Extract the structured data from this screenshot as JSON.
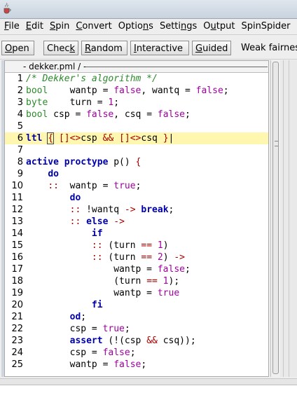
{
  "titlebar": {
    "icon": "java-cup-icon"
  },
  "menu": [
    {
      "pre": "",
      "ul": "F",
      "post": "ile"
    },
    {
      "pre": "",
      "ul": "E",
      "post": "dit"
    },
    {
      "pre": "",
      "ul": "S",
      "post": "pin"
    },
    {
      "pre": "",
      "ul": "C",
      "post": "onvert"
    },
    {
      "pre": "Optio",
      "ul": "n",
      "post": "s"
    },
    {
      "pre": "Setti",
      "ul": "n",
      "post": "gs"
    },
    {
      "pre": "O",
      "ul": "u",
      "post": "tput"
    },
    {
      "pre": "SpinSpider",
      "ul": "",
      "post": ""
    }
  ],
  "toolbar": {
    "open": {
      "pre": "",
      "ul": "O",
      "post": "pen"
    },
    "check": {
      "pre": "Chec",
      "ul": "k",
      "post": ""
    },
    "random": {
      "pre": "",
      "ul": "R",
      "post": "andom"
    },
    "interactive": {
      "pre": "",
      "ul": "I",
      "post": "nteractive"
    },
    "guided": {
      "pre": "",
      "ul": "G",
      "post": "uided"
    },
    "weak": {
      "pre": "Weak fairness",
      "ul": "",
      "post": ""
    }
  },
  "editor": {
    "tab_title": "- dekker.pml / -",
    "lines": [
      {
        "n": "1",
        "html": "<span class='cm'>/* Dekker's algorithm */</span>"
      },
      {
        "n": "2",
        "html": "<span class='ty'>bool</span>    wantp = <span class='lit'>false</span>, wantq = <span class='lit'>false</span>;"
      },
      {
        "n": "3",
        "html": "<span class='ty'>byte</span>    turn = <span class='lit'>1</span>;"
      },
      {
        "n": "4",
        "html": "<span class='ty'>bool</span> csp = <span class='lit'>false</span>, csq = <span class='lit'>false</span>;"
      },
      {
        "n": "5",
        "html": ""
      },
      {
        "n": "6",
        "html": "<span class='kw'>ltl</span> <span class='op brk'>{</span> <span class='op'>[]&lt;&gt;</span>csp <span class='op'>&amp;&amp;</span> <span class='op'>[]&lt;&gt;</span>csq <span class='op'>}</span>|",
        "hl": true
      },
      {
        "n": "7",
        "html": ""
      },
      {
        "n": "8",
        "html": "<span class='kw'>active proctype</span> p() <span class='op'>{</span>"
      },
      {
        "n": "9",
        "html": "    <span class='kw'>do</span>"
      },
      {
        "n": "10",
        "html": "    <span class='op'>::</span>  wantp = <span class='lit'>true</span>;"
      },
      {
        "n": "11",
        "html": "        <span class='kw'>do</span>"
      },
      {
        "n": "12",
        "html": "        <span class='op'>::</span> !wantq <span class='op'>-&gt;</span> <span class='kw'>break</span>;"
      },
      {
        "n": "13",
        "html": "        <span class='op'>::</span> <span class='kw'>else</span> <span class='op'>-&gt;</span>"
      },
      {
        "n": "14",
        "html": "            <span class='kw'>if</span>"
      },
      {
        "n": "15",
        "html": "            <span class='op'>::</span> (turn <span class='op'>==</span> <span class='lit'>1</span>)"
      },
      {
        "n": "16",
        "html": "            <span class='op'>::</span> (turn <span class='op'>==</span> <span class='lit'>2</span>) <span class='op'>-&gt;</span>"
      },
      {
        "n": "17",
        "html": "                wantp = <span class='lit'>false</span>;"
      },
      {
        "n": "18",
        "html": "                (turn <span class='op'>==</span> <span class='lit'>1</span>);"
      },
      {
        "n": "19",
        "html": "                wantp = <span class='lit'>true</span>"
      },
      {
        "n": "20",
        "html": "            <span class='kw'>fi</span>"
      },
      {
        "n": "21",
        "html": "        <span class='kw'>od</span>;"
      },
      {
        "n": "22",
        "html": "        csp = <span class='lit'>true</span>;"
      },
      {
        "n": "23",
        "html": "        <span class='kw'>assert</span> (!(csp <span class='op'>&amp;&amp;</span> csq));"
      },
      {
        "n": "24",
        "html": "        csp = <span class='lit'>false</span>;"
      },
      {
        "n": "25",
        "html": "        wantp = <span class='lit'>false</span>;"
      }
    ]
  },
  "colors": {
    "comment": "#2b8a2b",
    "keyword": "#0000aa",
    "literal": "#a000a0",
    "operator": "#aa0000",
    "highlight": "#fff7b0"
  }
}
